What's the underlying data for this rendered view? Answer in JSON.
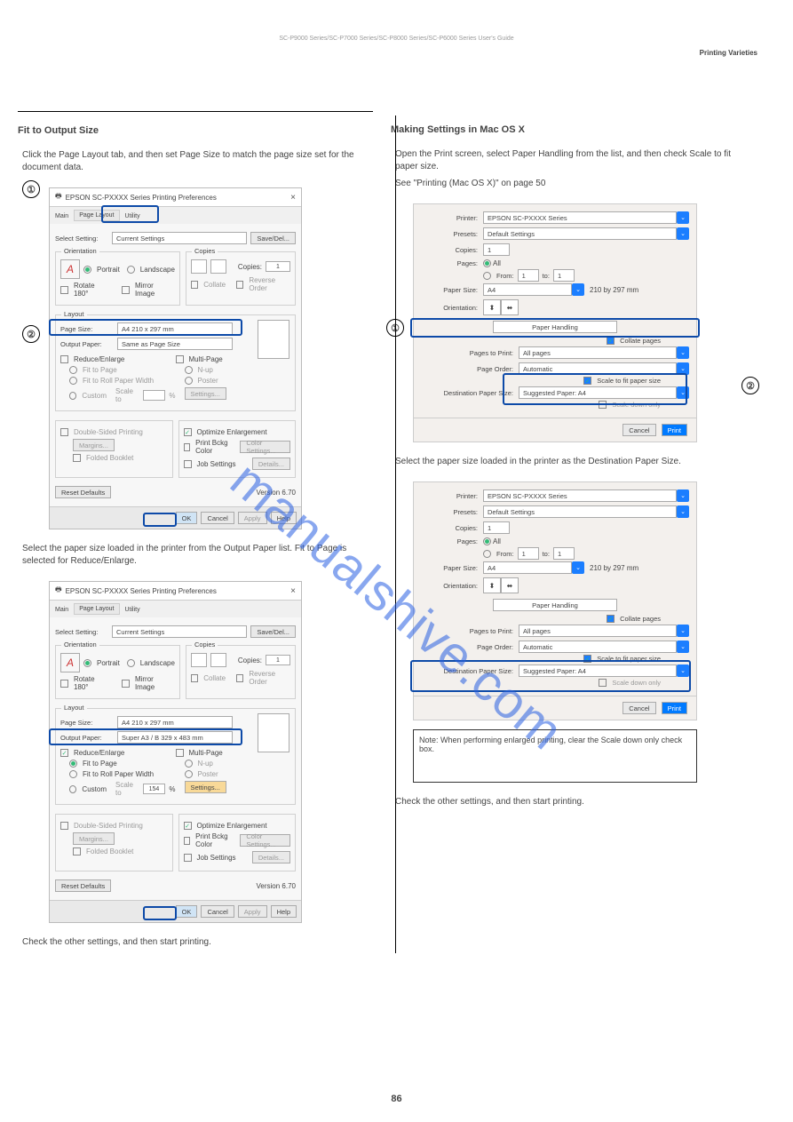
{
  "header": {
    "top_line": "SC-P9000 Series/SC-P7000 Series/SC-P8000 Series/SC-P6000 Series     User's Guide",
    "section": "Printing Varieties"
  },
  "left": {
    "title": "Fit to Output Size",
    "step1": "Click the Page Layout tab, and then set Page Size to match the page size set for the document data.",
    "dlg1": {
      "title": "EPSON SC-PXXXX Series Printing Preferences",
      "tab_main": "Main",
      "tab_layout": "Page Layout",
      "tab_utility": "Utility",
      "select_setting_lbl": "Select Setting:",
      "select_setting_val": "Current Settings",
      "save_del": "Save/Del...",
      "orientation": "Orientation",
      "portrait": "Portrait",
      "landscape": "Landscape",
      "copies_title": "Copies",
      "copies_lbl": "Copies:",
      "copies_val": "1",
      "rotate": "Rotate 180°",
      "mirror": "Mirror Image",
      "collate": "Collate",
      "reverse": "Reverse Order",
      "layout": "Layout",
      "page_size_lbl": "Page Size:",
      "page_size_val": "A4 210 x 297 mm",
      "output_paper_lbl": "Output Paper:",
      "output_paper_val": "Same as Page Size",
      "reduce_enlarge": "Reduce/Enlarge",
      "fit_to_page": "Fit to Page",
      "fit_roll": "Fit to Roll Paper Width",
      "custom": "Custom",
      "scale_lbl": "Scale to",
      "multipage": "Multi-Page",
      "nup": "N-up",
      "poster": "Poster",
      "settings": "Settings...",
      "doublesided": "Double-Sided Printing",
      "margins": "Margins...",
      "folded": "Folded Booklet",
      "optimize": "Optimize Enlargement",
      "bkg": "Print Bckg Color",
      "color_settings": "Color Settings...",
      "job": "Job Settings",
      "details": "Details...",
      "reset": "Reset Defaults",
      "version": "Version 6.70",
      "ok": "OK",
      "cancel": "Cancel",
      "apply": "Apply",
      "help": "Help"
    },
    "step2": "Select the paper size loaded in the printer from the Output Paper list. Fit to Page is selected for Reduce/Enlarge.",
    "dlg2": {
      "output_paper_val": "Super A3 / B 329 x 483 mm",
      "scale_val": "154"
    },
    "step3": "Check the other settings, and then start printing."
  },
  "right": {
    "title": "Making Settings in Mac OS X",
    "step1": "Open the Print screen, select Paper Handling from the list, and then check Scale to fit paper size.",
    "see": "See \"Printing (Mac OS X)\" on page 50",
    "mac": {
      "printer_lbl": "Printer:",
      "printer_val": "EPSON SC-PXXXX Series",
      "presets_lbl": "Presets:",
      "presets_val": "Default Settings",
      "copies_lbl": "Copies:",
      "copies_val": "1",
      "pages_lbl": "Pages:",
      "pages_all": "All",
      "pages_from": "From:",
      "pages_from_val": "1",
      "pages_to": "to:",
      "pages_to_val": "1",
      "paper_size_lbl": "Paper Size:",
      "paper_size_val": "A4",
      "paper_size_dim": "210 by 297 mm",
      "orientation_lbl": "Orientation:",
      "section_dd": "Paper Handling",
      "collate": "Collate pages",
      "pages_to_print_lbl": "Pages to Print:",
      "pages_to_print_val": "All pages",
      "page_order_lbl": "Page Order:",
      "page_order_val": "Automatic",
      "scale_fit": "Scale to fit paper size",
      "dest_lbl": "Destination Paper Size:",
      "dest_val": "Suggested Paper: A4",
      "scale_down": "Scale down only",
      "cancel": "Cancel",
      "print": "Print"
    },
    "step2": "Select the paper size loaded in the printer as the Destination Paper Size.",
    "note": "Note: When performing enlarged printing, clear the Scale down only check box.",
    "step3": "Check the other settings, and then start printing."
  },
  "watermark": "manualshive.com",
  "page_number": "86"
}
